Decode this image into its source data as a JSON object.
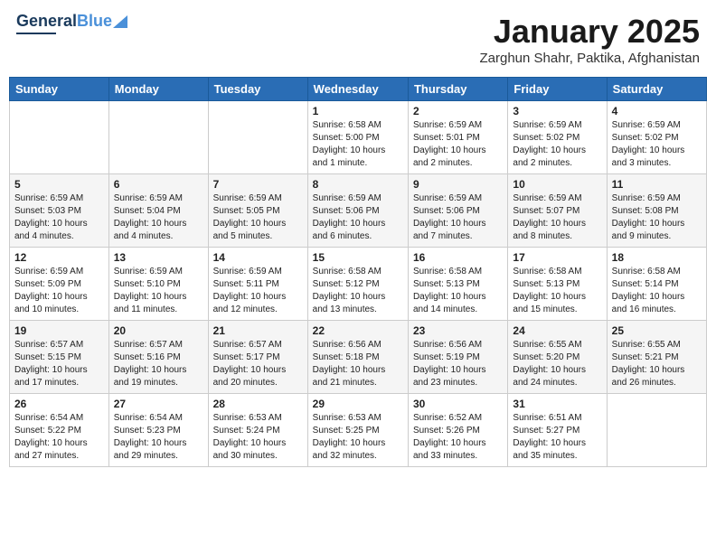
{
  "header": {
    "logo_general": "General",
    "logo_blue": "Blue",
    "title": "January 2025",
    "location": "Zarghun Shahr, Paktika, Afghanistan"
  },
  "weekdays": [
    "Sunday",
    "Monday",
    "Tuesday",
    "Wednesday",
    "Thursday",
    "Friday",
    "Saturday"
  ],
  "weeks": [
    [
      {
        "day": "",
        "info": ""
      },
      {
        "day": "",
        "info": ""
      },
      {
        "day": "",
        "info": ""
      },
      {
        "day": "1",
        "info": "Sunrise: 6:58 AM\nSunset: 5:00 PM\nDaylight: 10 hours\nand 1 minute."
      },
      {
        "day": "2",
        "info": "Sunrise: 6:59 AM\nSunset: 5:01 PM\nDaylight: 10 hours\nand 2 minutes."
      },
      {
        "day": "3",
        "info": "Sunrise: 6:59 AM\nSunset: 5:02 PM\nDaylight: 10 hours\nand 2 minutes."
      },
      {
        "day": "4",
        "info": "Sunrise: 6:59 AM\nSunset: 5:02 PM\nDaylight: 10 hours\nand 3 minutes."
      }
    ],
    [
      {
        "day": "5",
        "info": "Sunrise: 6:59 AM\nSunset: 5:03 PM\nDaylight: 10 hours\nand 4 minutes."
      },
      {
        "day": "6",
        "info": "Sunrise: 6:59 AM\nSunset: 5:04 PM\nDaylight: 10 hours\nand 4 minutes."
      },
      {
        "day": "7",
        "info": "Sunrise: 6:59 AM\nSunset: 5:05 PM\nDaylight: 10 hours\nand 5 minutes."
      },
      {
        "day": "8",
        "info": "Sunrise: 6:59 AM\nSunset: 5:06 PM\nDaylight: 10 hours\nand 6 minutes."
      },
      {
        "day": "9",
        "info": "Sunrise: 6:59 AM\nSunset: 5:06 PM\nDaylight: 10 hours\nand 7 minutes."
      },
      {
        "day": "10",
        "info": "Sunrise: 6:59 AM\nSunset: 5:07 PM\nDaylight: 10 hours\nand 8 minutes."
      },
      {
        "day": "11",
        "info": "Sunrise: 6:59 AM\nSunset: 5:08 PM\nDaylight: 10 hours\nand 9 minutes."
      }
    ],
    [
      {
        "day": "12",
        "info": "Sunrise: 6:59 AM\nSunset: 5:09 PM\nDaylight: 10 hours\nand 10 minutes."
      },
      {
        "day": "13",
        "info": "Sunrise: 6:59 AM\nSunset: 5:10 PM\nDaylight: 10 hours\nand 11 minutes."
      },
      {
        "day": "14",
        "info": "Sunrise: 6:59 AM\nSunset: 5:11 PM\nDaylight: 10 hours\nand 12 minutes."
      },
      {
        "day": "15",
        "info": "Sunrise: 6:58 AM\nSunset: 5:12 PM\nDaylight: 10 hours\nand 13 minutes."
      },
      {
        "day": "16",
        "info": "Sunrise: 6:58 AM\nSunset: 5:13 PM\nDaylight: 10 hours\nand 14 minutes."
      },
      {
        "day": "17",
        "info": "Sunrise: 6:58 AM\nSunset: 5:13 PM\nDaylight: 10 hours\nand 15 minutes."
      },
      {
        "day": "18",
        "info": "Sunrise: 6:58 AM\nSunset: 5:14 PM\nDaylight: 10 hours\nand 16 minutes."
      }
    ],
    [
      {
        "day": "19",
        "info": "Sunrise: 6:57 AM\nSunset: 5:15 PM\nDaylight: 10 hours\nand 17 minutes."
      },
      {
        "day": "20",
        "info": "Sunrise: 6:57 AM\nSunset: 5:16 PM\nDaylight: 10 hours\nand 19 minutes."
      },
      {
        "day": "21",
        "info": "Sunrise: 6:57 AM\nSunset: 5:17 PM\nDaylight: 10 hours\nand 20 minutes."
      },
      {
        "day": "22",
        "info": "Sunrise: 6:56 AM\nSunset: 5:18 PM\nDaylight: 10 hours\nand 21 minutes."
      },
      {
        "day": "23",
        "info": "Sunrise: 6:56 AM\nSunset: 5:19 PM\nDaylight: 10 hours\nand 23 minutes."
      },
      {
        "day": "24",
        "info": "Sunrise: 6:55 AM\nSunset: 5:20 PM\nDaylight: 10 hours\nand 24 minutes."
      },
      {
        "day": "25",
        "info": "Sunrise: 6:55 AM\nSunset: 5:21 PM\nDaylight: 10 hours\nand 26 minutes."
      }
    ],
    [
      {
        "day": "26",
        "info": "Sunrise: 6:54 AM\nSunset: 5:22 PM\nDaylight: 10 hours\nand 27 minutes."
      },
      {
        "day": "27",
        "info": "Sunrise: 6:54 AM\nSunset: 5:23 PM\nDaylight: 10 hours\nand 29 minutes."
      },
      {
        "day": "28",
        "info": "Sunrise: 6:53 AM\nSunset: 5:24 PM\nDaylight: 10 hours\nand 30 minutes."
      },
      {
        "day": "29",
        "info": "Sunrise: 6:53 AM\nSunset: 5:25 PM\nDaylight: 10 hours\nand 32 minutes."
      },
      {
        "day": "30",
        "info": "Sunrise: 6:52 AM\nSunset: 5:26 PM\nDaylight: 10 hours\nand 33 minutes."
      },
      {
        "day": "31",
        "info": "Sunrise: 6:51 AM\nSunset: 5:27 PM\nDaylight: 10 hours\nand 35 minutes."
      },
      {
        "day": "",
        "info": ""
      }
    ]
  ]
}
